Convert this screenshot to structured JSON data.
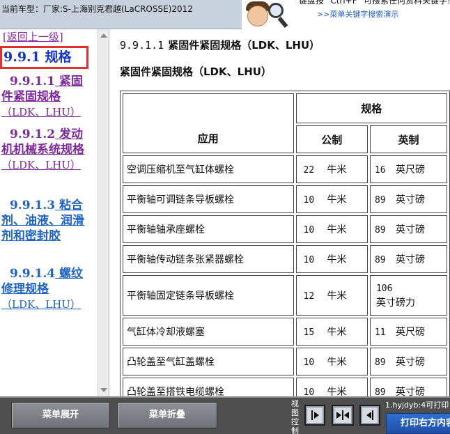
{
  "header": {
    "vehicle": "当前车型：厂家:S-上海别克君越(LaCROSSE)2012",
    "tip_line1": "键盘按\"Ctrl+F\"可搜索任何资料关键字!",
    "tip_line1_visible": "键盘按 \"Ctrl+F\" 可搜索任何资料关键字!",
    "tip_demo": ">>菜单关键字搜索演示"
  },
  "nav": {
    "back": "[返回上一级]",
    "current": "9.9.1 规格",
    "items": [
      {
        "num": "9.9.1.1",
        "label": "紧固件紧固规格",
        "sub": "（LDK、LHU）"
      },
      {
        "num": "9.9.1.2",
        "label": "发动机机械系统规格",
        "sub": "（LDK、LHU）"
      },
      {
        "num": "9.9.1.3",
        "label": "粘合剂、油液、润滑剂和密封胶",
        "sub": ""
      },
      {
        "num": "9.9.1.4",
        "label": "螺纹修理规格",
        "sub": "（LDK、LHU）"
      }
    ]
  },
  "main": {
    "section_num": "9.9.1.1",
    "section_title": "紧固件紧固规格（LDK、LHU）",
    "subtitle": "紧固件紧固规格（LDK、LHU）",
    "table": {
      "headers": {
        "app": "应用",
        "spec": "规格",
        "metric": "公制",
        "imperial": "英制"
      },
      "rows": [
        {
          "app": "空调压缩机至气缸体螺栓",
          "metric_val": "22",
          "metric_unit": "牛米",
          "imp_val": "16",
          "imp_unit": "英尺磅"
        },
        {
          "app": "平衡轴可调链条导板螺栓",
          "metric_val": "10",
          "metric_unit": "牛米",
          "imp_val": "89",
          "imp_unit": "英寸磅"
        },
        {
          "app": "平衡轴轴承座螺栓",
          "metric_val": "10",
          "metric_unit": "牛米",
          "imp_val": "89",
          "imp_unit": "英寸磅"
        },
        {
          "app": "平衡轴传动链条张紧器螺栓",
          "metric_val": "10",
          "metric_unit": "牛米",
          "imp_val": "89",
          "imp_unit": "英寸磅"
        },
        {
          "app": "平衡轴固定链条导板螺栓",
          "metric_val": "12",
          "metric_unit": "牛米",
          "imp_val": "106",
          "imp_unit": "英寸磅力"
        },
        {
          "app": "气缸体冷却液螺塞",
          "metric_val": "15",
          "metric_unit": "牛米",
          "imp_val": "11",
          "imp_unit": "英尺磅"
        },
        {
          "app": "凸轮盖至气缸盖螺栓",
          "metric_val": "10",
          "metric_unit": "牛米",
          "imp_val": "89",
          "imp_unit": "英寸磅"
        },
        {
          "app": "凸轮盖至搭铁电缆螺栓",
          "metric_val": "10",
          "metric_unit": "牛米",
          "imp_val": "89",
          "imp_unit": "英寸磅"
        }
      ]
    }
  },
  "footer": {
    "expand": "菜单展开",
    "collapse": "菜单折叠",
    "view_control": "视图控制",
    "path": "1.hyjdyb:4可打印",
    "print": "打印右方内容"
  }
}
